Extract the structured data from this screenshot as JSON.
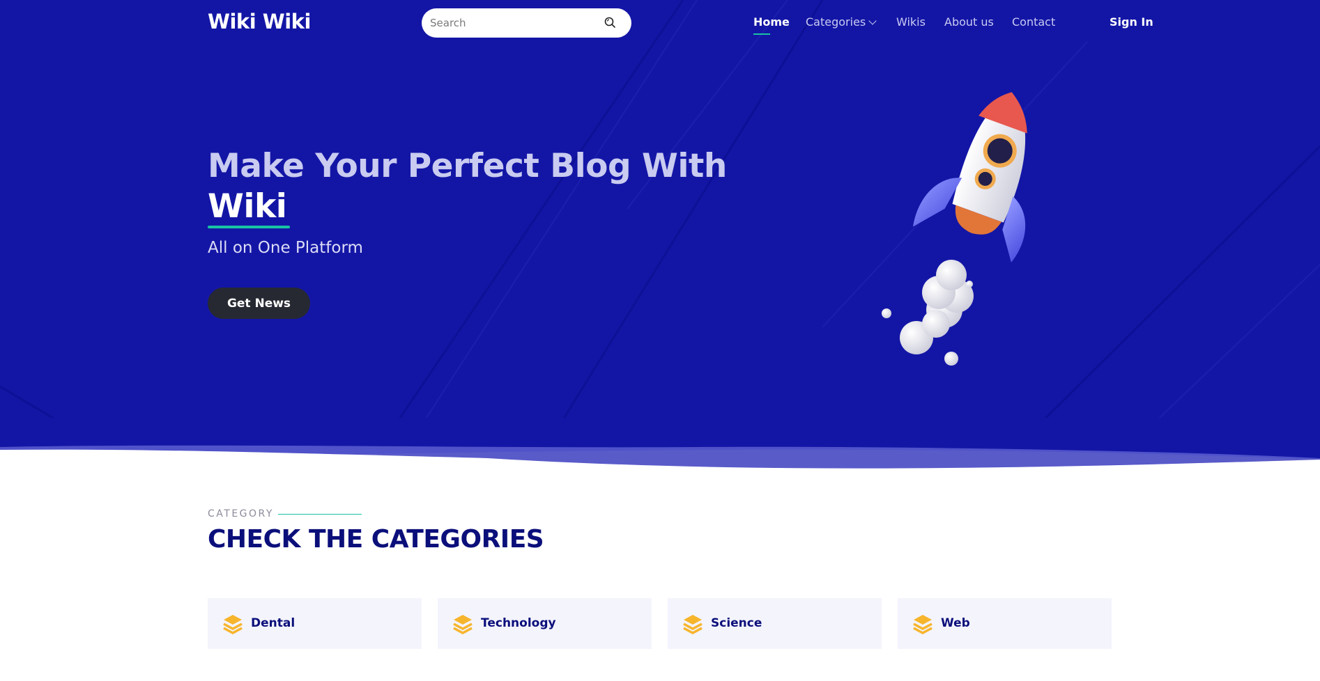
{
  "brand": {
    "logo_text": "Wiki Wiki"
  },
  "search": {
    "placeholder": "Search",
    "icon": "search-icon"
  },
  "nav": {
    "items": [
      {
        "label": "Home",
        "active": true
      },
      {
        "label": "Categories",
        "has_dropdown": true
      },
      {
        "label": "Wikis"
      },
      {
        "label": "About us"
      },
      {
        "label": "Contact"
      }
    ],
    "sign_in": "Sign In"
  },
  "hero": {
    "title_line1": "Make Your Perfect Blog With",
    "title_accent": "Wiki",
    "subtitle": "All on One Platform",
    "cta_label": "Get News",
    "image": "rocket-illustration"
  },
  "categories_section": {
    "eyebrow": "CATEGORY",
    "title": "CHECK THE CATEGORIES",
    "cards": [
      {
        "label": "Dental",
        "icon": "layers-icon"
      },
      {
        "label": "Technology",
        "icon": "layers-icon"
      },
      {
        "label": "Science",
        "icon": "layers-icon"
      },
      {
        "label": "Web",
        "icon": "layers-icon"
      }
    ]
  },
  "colors": {
    "hero_bg": "#1316a5",
    "accent_green": "#19c3a3",
    "heading_navy": "#0b0f7a",
    "button_dark": "#272932",
    "card_bg": "#f4f4fd",
    "icon_orange": "#f7b52c"
  }
}
